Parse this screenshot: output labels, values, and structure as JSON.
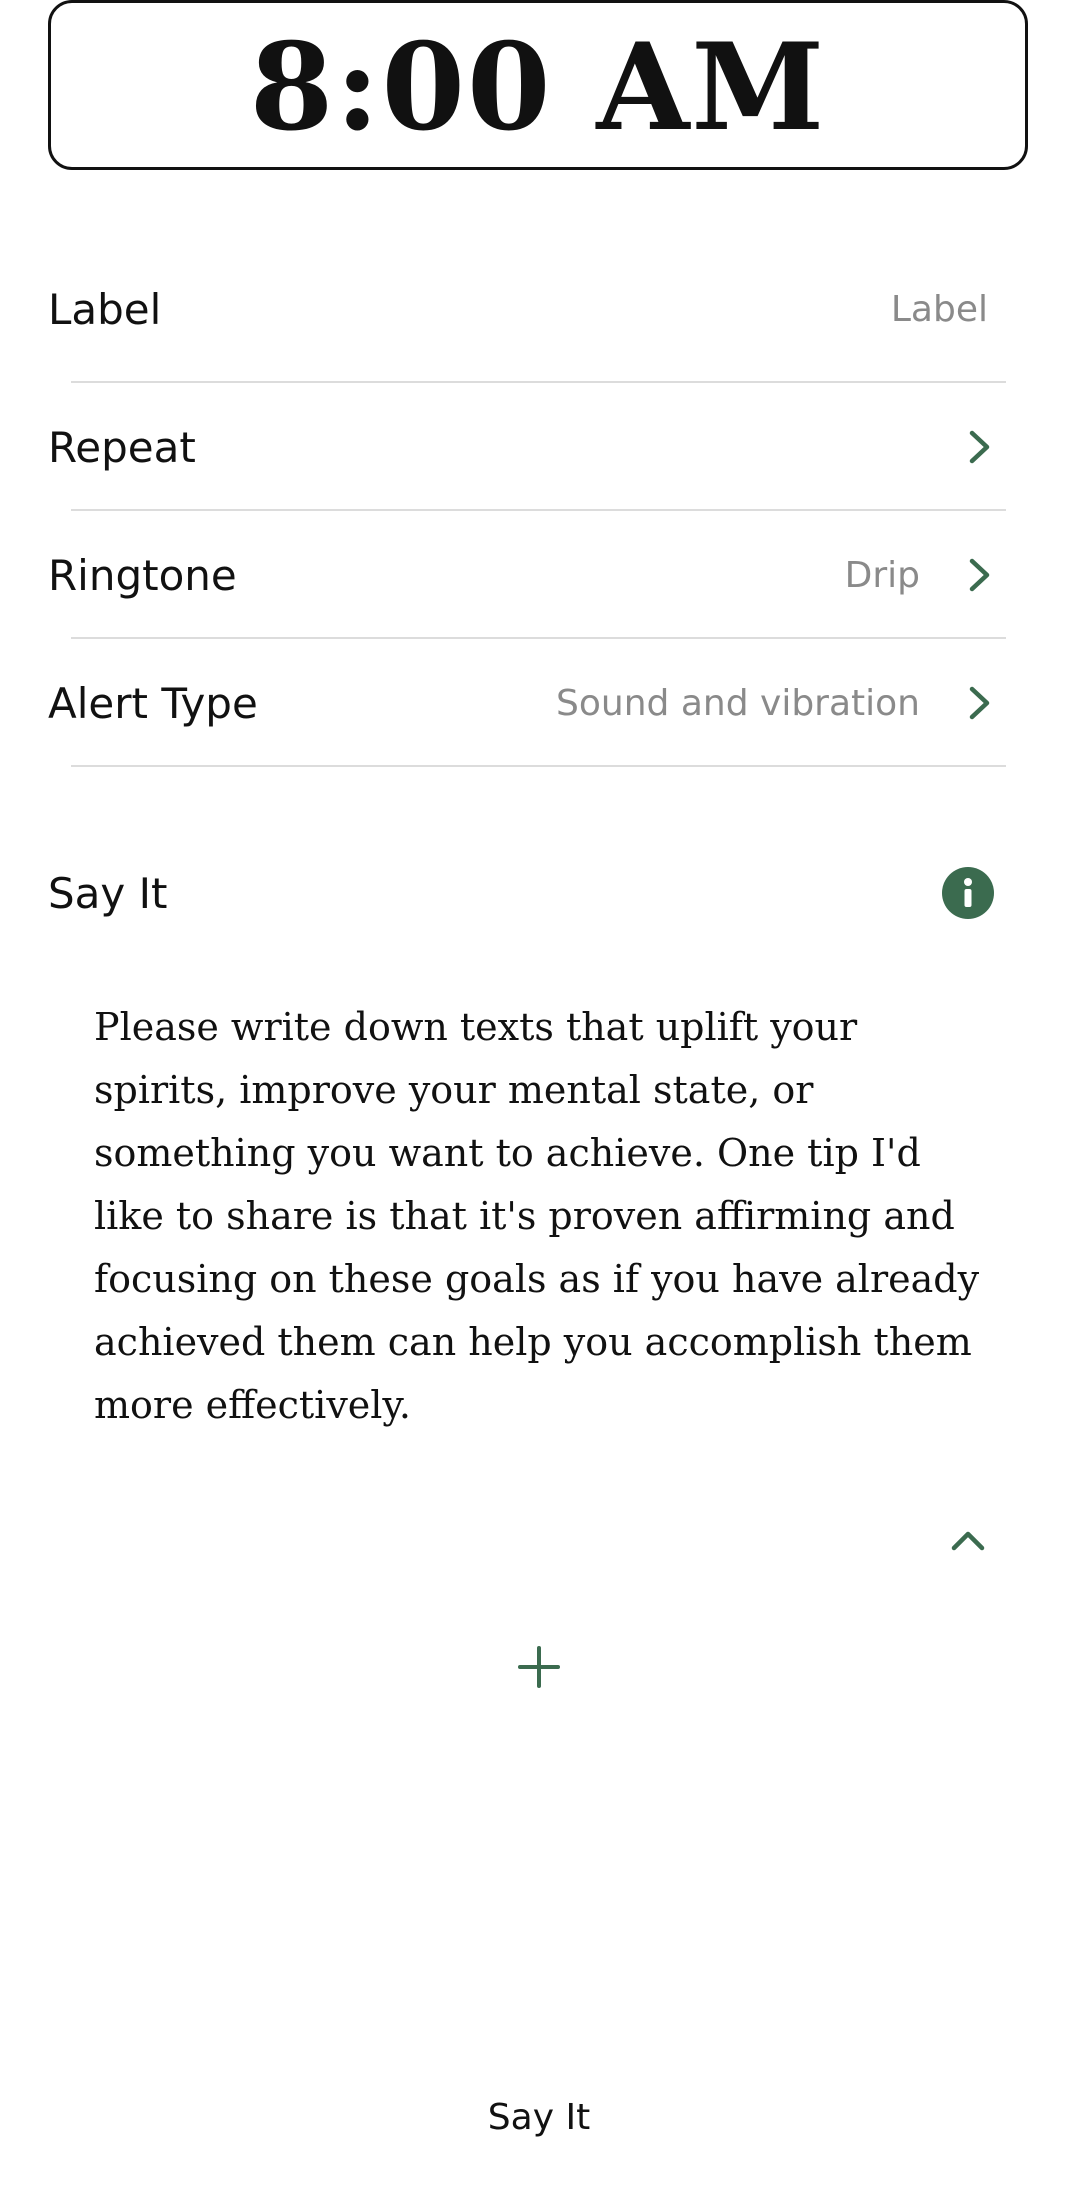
{
  "alarm": {
    "time": "8:00 AM"
  },
  "settings": {
    "label": {
      "title": "Label",
      "placeholder": "Label"
    },
    "repeat": {
      "title": "Repeat"
    },
    "ringtone": {
      "title": "Ringtone",
      "value": "Drip"
    },
    "alert_type": {
      "title": "Alert Type",
      "value": "Sound and vibration"
    }
  },
  "say_it": {
    "title": "Say It",
    "description": "Please write down texts that uplift your spirits, improve your mental state, or something you want to achieve. One tip I'd like to share is that it's proven affirming and focusing on these goals as if you have already achieved them can help you accomplish them more effectively."
  },
  "bottom_tab": {
    "label": "Say It"
  },
  "icons": {
    "chevron": "chevron-right-icon",
    "info": "info-icon",
    "collapse": "chevron-up-icon",
    "add": "plus-icon"
  },
  "colors": {
    "accent": "#3b6b4f",
    "secondary_text": "#8a8a8a",
    "divider": "#dcdcdc"
  }
}
